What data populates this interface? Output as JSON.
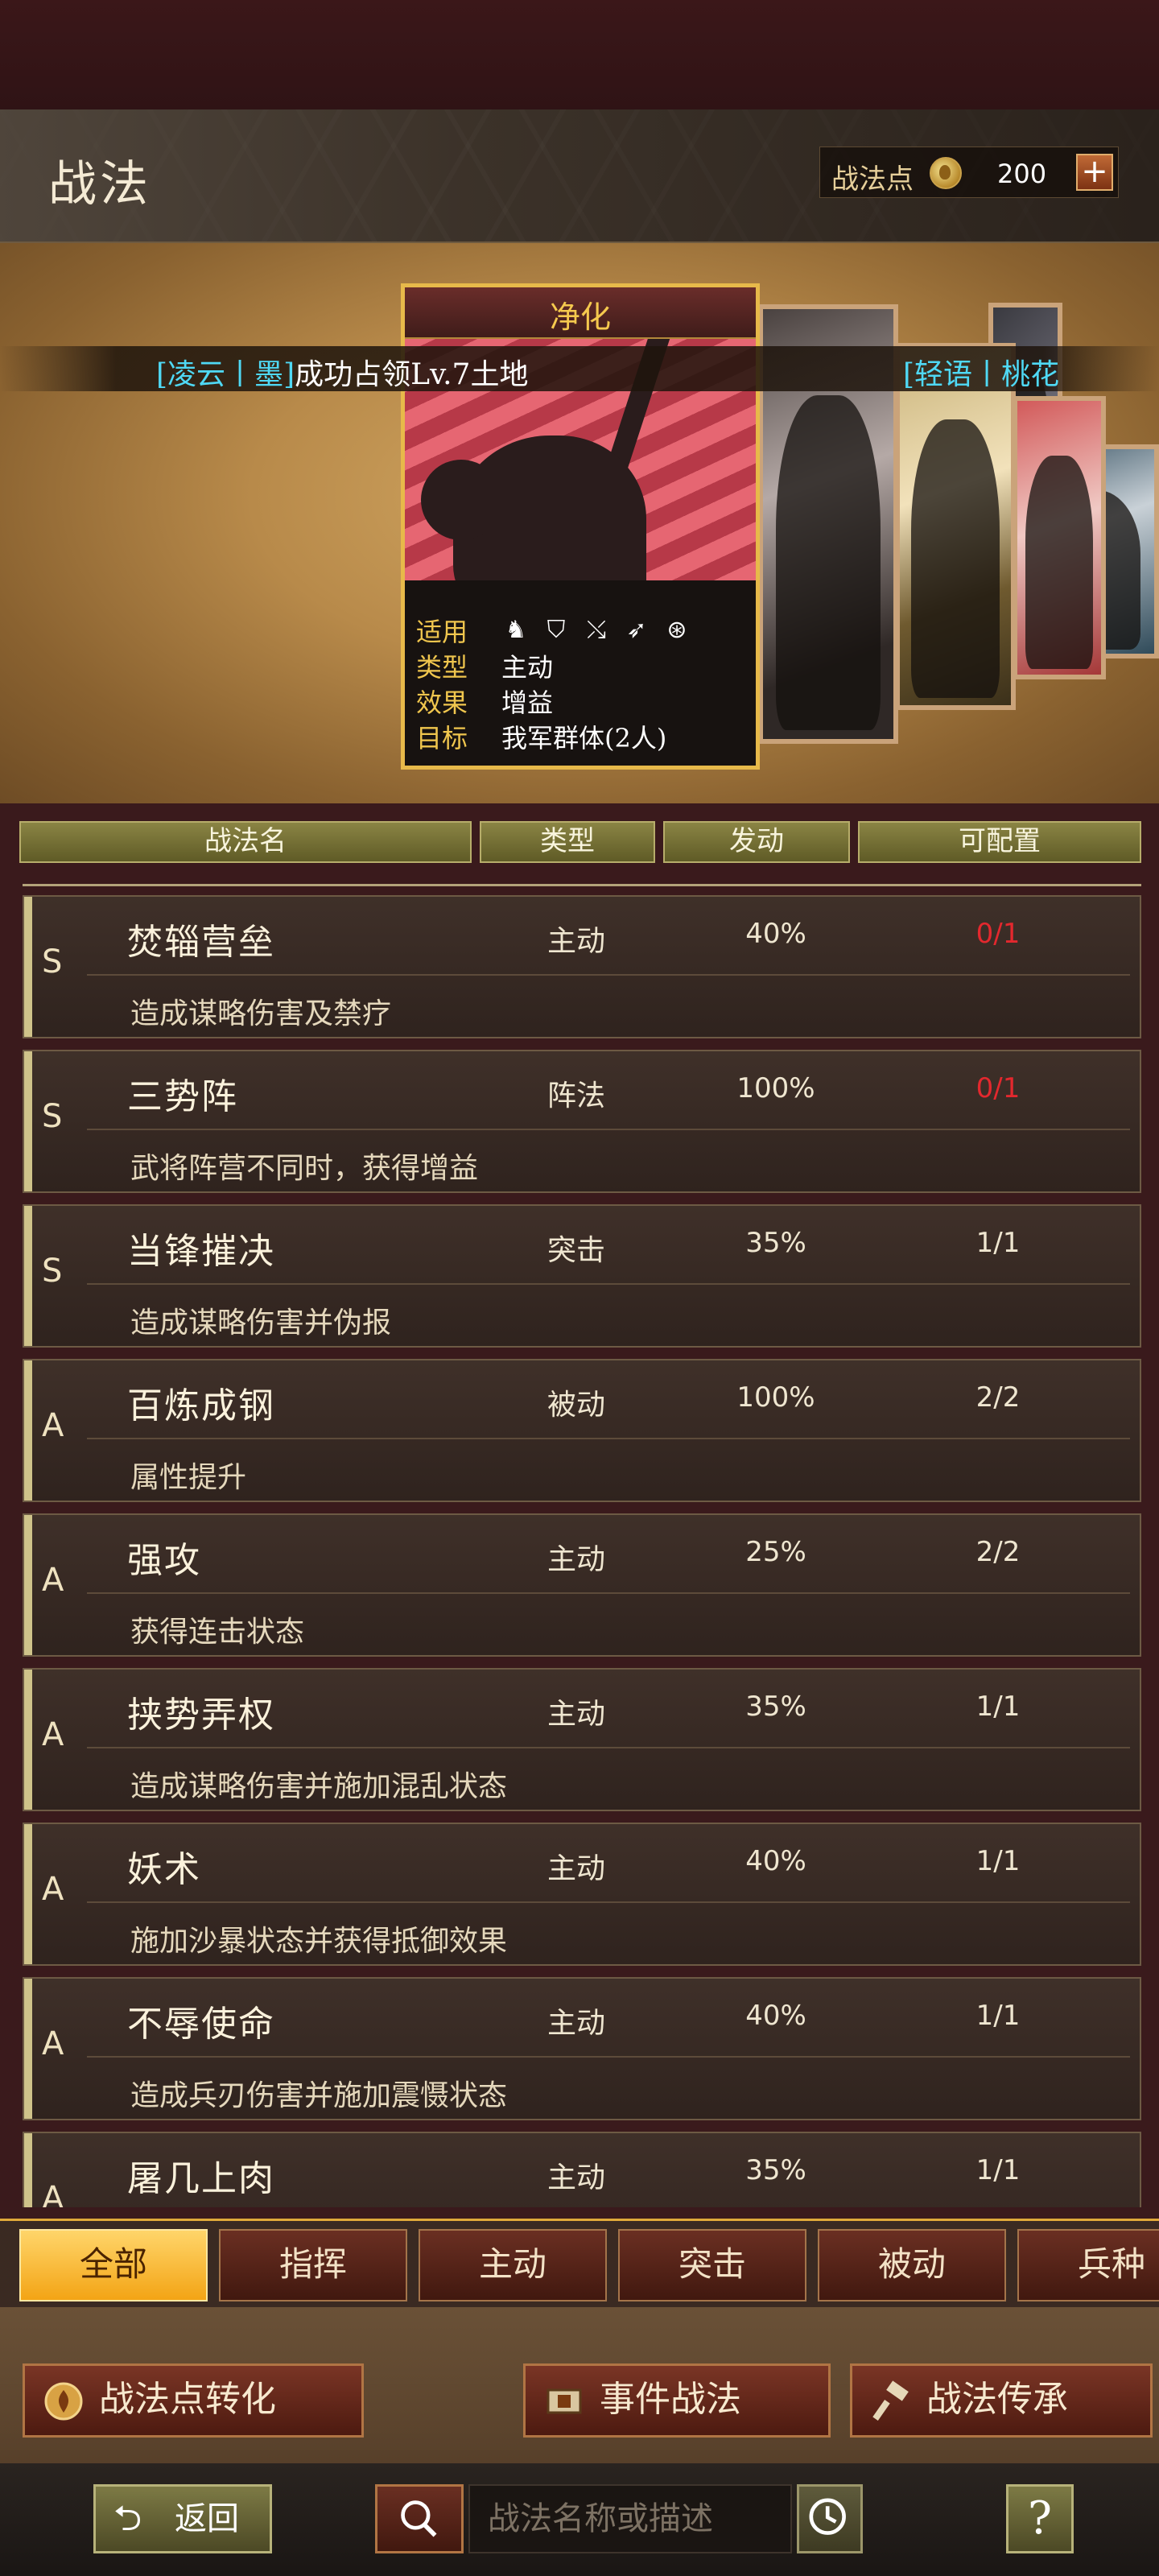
{
  "header": {
    "title": "战法",
    "points_label": "战法点",
    "points_value": "200",
    "plus_label": "+"
  },
  "featured": {
    "title": "净化",
    "stats": [
      {
        "key": "适用",
        "value": ""
      },
      {
        "key": "类型",
        "value": "主动"
      },
      {
        "key": "效果",
        "value": "增益"
      },
      {
        "key": "目标",
        "value": "我军群体(2人)"
      }
    ],
    "troop_icons": [
      "cavalry-icon",
      "shield-icon",
      "archer-icon",
      "spear-icon",
      "chariot-icon"
    ]
  },
  "ticker": {
    "m1_name": "凌云",
    "m1_sep": "丨",
    "m1_alliance": "墨",
    "m1_text": "成功占领Lv.7土地",
    "m2_name": "轻语",
    "m2_sep": "丨",
    "m2_alliance": "桃花"
  },
  "table": {
    "headers": [
      "战法名",
      "类型",
      "发动",
      "可配置"
    ]
  },
  "tactics": [
    {
      "grade": "S",
      "name": "焚辎营垒",
      "type": "主动",
      "rate": "40%",
      "avail": "0/1",
      "desc": "造成谋略伤害及禁疗",
      "red": true
    },
    {
      "grade": "S",
      "name": "三势阵",
      "type": "阵法",
      "rate": "100%",
      "avail": "0/1",
      "desc": "武将阵营不同时，获得增益",
      "red": true
    },
    {
      "grade": "S",
      "name": "当锋摧决",
      "type": "突击",
      "rate": "35%",
      "avail": "1/1",
      "desc": "造成谋略伤害并伪报",
      "red": false
    },
    {
      "grade": "A",
      "name": "百炼成钢",
      "type": "被动",
      "rate": "100%",
      "avail": "2/2",
      "desc": "属性提升",
      "red": false
    },
    {
      "grade": "A",
      "name": "强攻",
      "type": "主动",
      "rate": "25%",
      "avail": "2/2",
      "desc": "获得连击状态",
      "red": false
    },
    {
      "grade": "A",
      "name": "挟势弄权",
      "type": "主动",
      "rate": "35%",
      "avail": "1/1",
      "desc": "造成谋略伤害并施加混乱状态",
      "red": false
    },
    {
      "grade": "A",
      "name": "妖术",
      "type": "主动",
      "rate": "40%",
      "avail": "1/1",
      "desc": "施加沙暴状态并获得抵御效果",
      "red": false
    },
    {
      "grade": "A",
      "name": "不辱使命",
      "type": "主动",
      "rate": "40%",
      "avail": "1/1",
      "desc": "造成兵刃伤害并施加震慑状态",
      "red": false
    },
    {
      "grade": "A",
      "name": "屠几上肉",
      "type": "主动",
      "rate": "35%",
      "avail": "1/1",
      "desc": "",
      "red": false
    }
  ],
  "tabs": [
    "全部",
    "指挥",
    "主动",
    "突击",
    "被动",
    "兵种"
  ],
  "active_tab": "全部",
  "actions": {
    "convert": "战法点转化",
    "event": "事件战法",
    "inherit": "战法传承"
  },
  "bottom": {
    "back": "返回",
    "search_placeholder": "战法名称或描述",
    "help": "?"
  },
  "colors": {
    "accent_gold": "#f0c64e",
    "ticker_cyan": "#4fd9f5",
    "unavailable_red": "#e3282e",
    "active_tab": "#f3a415"
  }
}
